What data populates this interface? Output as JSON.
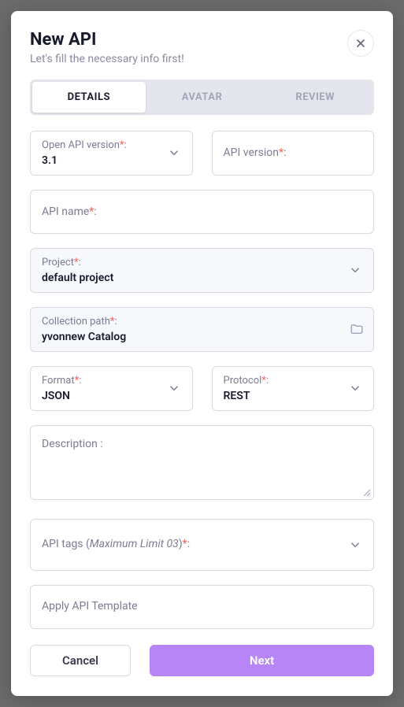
{
  "header": {
    "title": "New API",
    "subtitle": "Let's fill the necessary info first!"
  },
  "tabs": {
    "details": "DETAILS",
    "avatar": "AVATAR",
    "review": "REVIEW"
  },
  "fields": {
    "open_api_version": {
      "label": "Open API version",
      "value": "3.1"
    },
    "api_version": {
      "label": "API version"
    },
    "api_name": {
      "label": "API name"
    },
    "project": {
      "label": "Project",
      "value": "default project"
    },
    "collection_path": {
      "label": "Collection path",
      "value": "yvonnew Catalog"
    },
    "format": {
      "label": "Format",
      "value": "JSON"
    },
    "protocol": {
      "label": "Protocol",
      "value": "REST"
    },
    "description": {
      "label": "Description :"
    },
    "api_tags": {
      "label_prefix": "API tags (",
      "limit_text": "Maximum Limit 03",
      "label_suffix": ")"
    },
    "api_template": {
      "label": "Apply API Template"
    }
  },
  "buttons": {
    "cancel": "Cancel",
    "next": "Next"
  },
  "required_marker": "*",
  "colon": ":"
}
